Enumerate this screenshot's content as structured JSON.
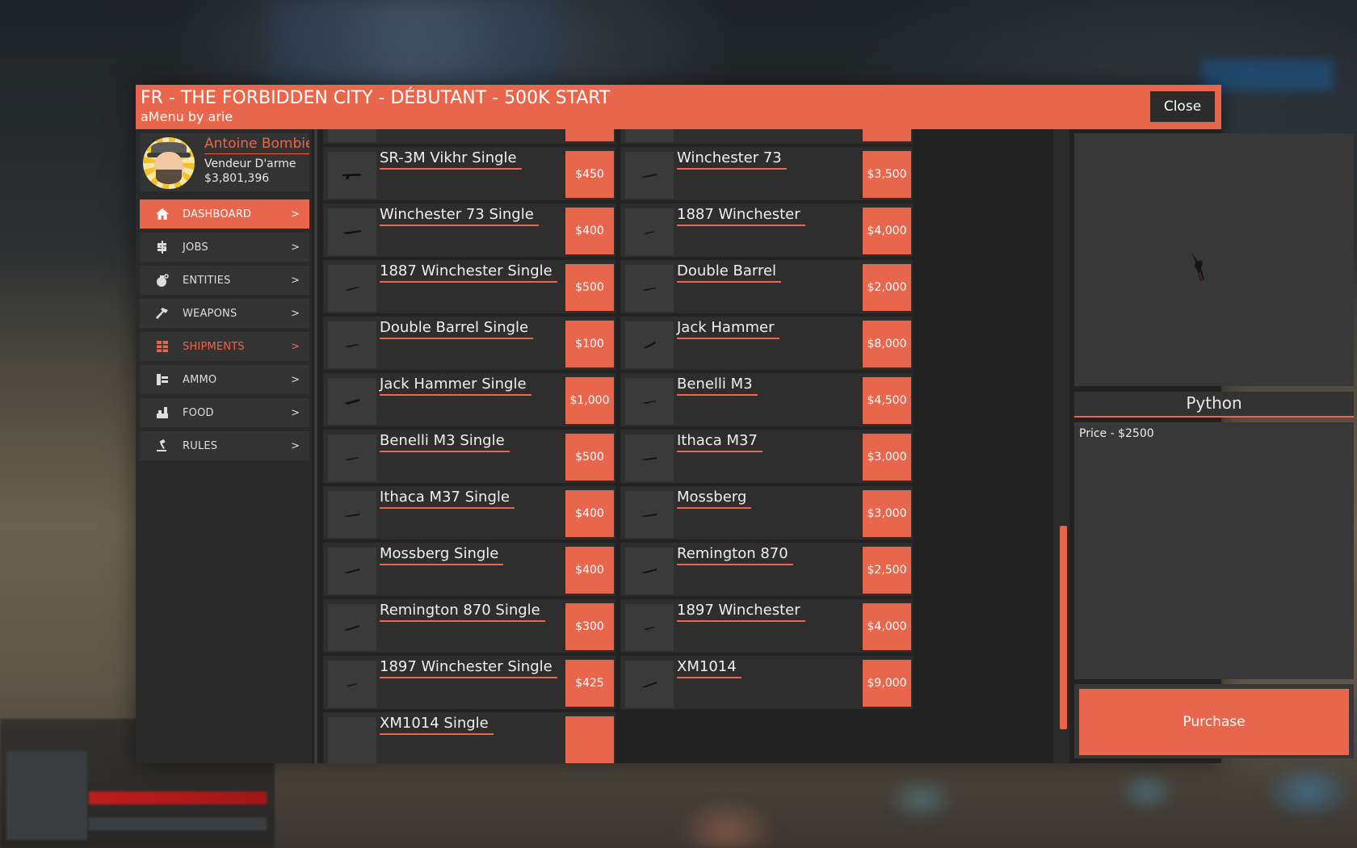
{
  "window": {
    "title": "FR - THE FORBIDDEN CITY - DÉBUTANT - 500K START",
    "subtitle": "aMenu by arie",
    "close_label": "Close"
  },
  "profile": {
    "name": "Antoine Bombie",
    "job": "Vendeur D'arme",
    "money": "$3,801,396"
  },
  "nav": [
    {
      "label": "DASHBOARD",
      "arrow": ">",
      "icon": "home-icon"
    },
    {
      "label": "JOBS",
      "arrow": ">",
      "icon": "dollar-icon"
    },
    {
      "label": "ENTITIES",
      "arrow": ">",
      "icon": "grenade-icon"
    },
    {
      "label": "WEAPONS",
      "arrow": ">",
      "icon": "hammer-icon"
    },
    {
      "label": "SHIPMENTS",
      "arrow": ">",
      "icon": "box-icon"
    },
    {
      "label": "AMMO",
      "arrow": ">",
      "icon": "ammo-icon"
    },
    {
      "label": "FOOD",
      "arrow": ">",
      "icon": "food-icon"
    },
    {
      "label": "RULES",
      "arrow": ">",
      "icon": "gavel-icon"
    }
  ],
  "items_left": [
    {
      "name": "",
      "price": ""
    },
    {
      "name": "SR-3M Vikhr Single",
      "price": "$450"
    },
    {
      "name": "Winchester 73 Single",
      "price": "$400"
    },
    {
      "name": "1887 Winchester Single",
      "price": "$500"
    },
    {
      "name": "Double Barrel Single",
      "price": "$100"
    },
    {
      "name": "Jack Hammer Single",
      "price": "$1,000"
    },
    {
      "name": "Benelli M3 Single",
      "price": "$500"
    },
    {
      "name": "Ithaca M37 Single",
      "price": "$400"
    },
    {
      "name": "Mossberg Single",
      "price": "$400"
    },
    {
      "name": "Remington 870 Single",
      "price": "$300"
    },
    {
      "name": "1897 Winchester Single",
      "price": "$425"
    },
    {
      "name": "XM1014 Single",
      "price": ""
    }
  ],
  "items_right": [
    {
      "name": "",
      "price": ""
    },
    {
      "name": "Winchester 73",
      "price": "$3,500"
    },
    {
      "name": "1887 Winchester",
      "price": "$4,000"
    },
    {
      "name": "Double Barrel",
      "price": "$2,000"
    },
    {
      "name": "Jack Hammer",
      "price": "$8,000"
    },
    {
      "name": "Benelli M3",
      "price": "$4,500"
    },
    {
      "name": "Ithaca M37",
      "price": "$3,000"
    },
    {
      "name": "Mossberg",
      "price": "$3,000"
    },
    {
      "name": "Remington 870",
      "price": "$2,500"
    },
    {
      "name": "1897 Winchester",
      "price": "$4,000"
    },
    {
      "name": "XM1014",
      "price": "$9,000"
    }
  ],
  "detail": {
    "title": "Python",
    "description": "Price - $2500",
    "purchase_label": "Purchase"
  },
  "colors": {
    "accent": "#e8664b",
    "panel": "#2e2e2e",
    "background": "#222222"
  }
}
